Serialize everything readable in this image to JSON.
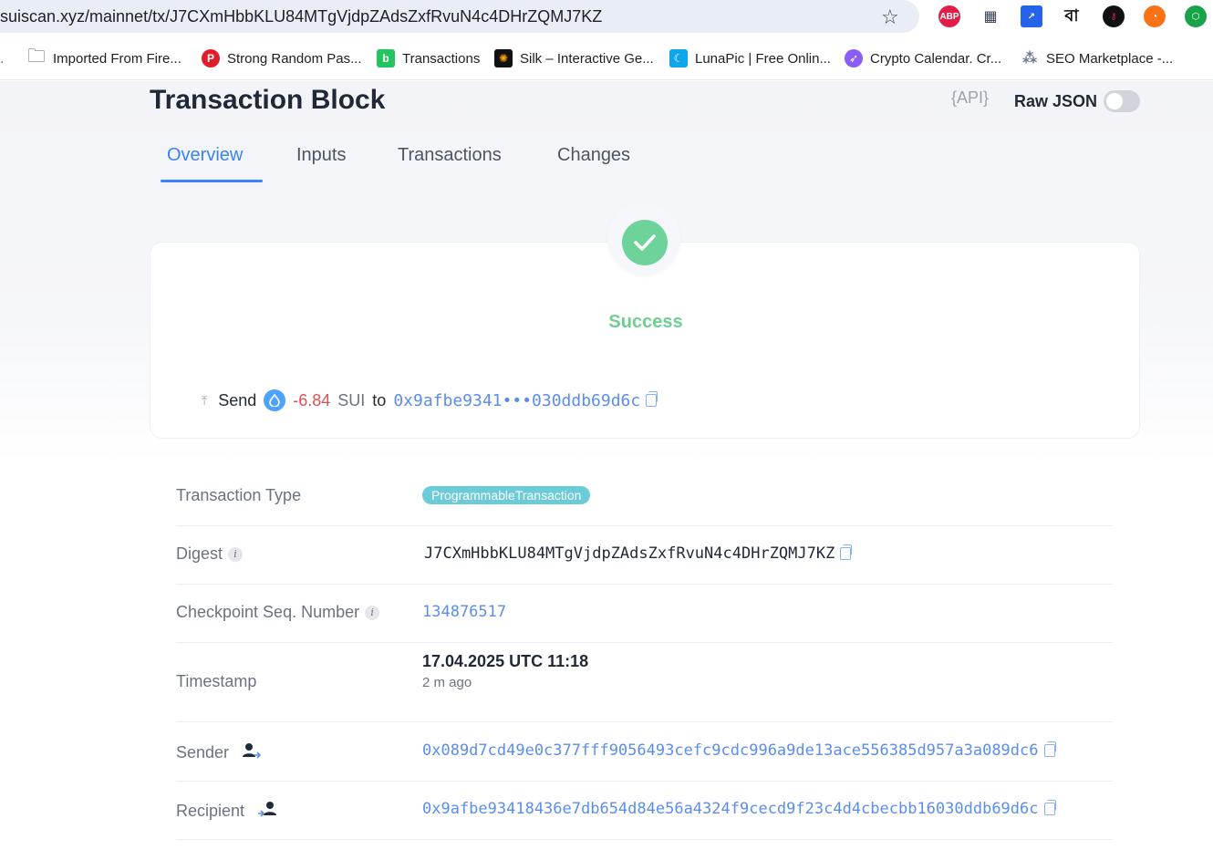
{
  "browser": {
    "url": "suiscan.xyz/mainnet/tx/J7CXmHbbKLU84MTgVjdpZAdsZxfRvuN4c4DHrZQMJ7KZ",
    "star_icon": "star-icon",
    "extensions": [
      {
        "name": "ABP",
        "color": "#e11d48"
      },
      {
        "name": "qr",
        "color": "#374151"
      },
      {
        "name": "bookmark",
        "color": "#2563eb"
      },
      {
        "name": "বা",
        "color": "#111111"
      },
      {
        "name": "key",
        "color": "#111111"
      },
      {
        "name": "rss",
        "color": "#f97316"
      },
      {
        "name": "hex",
        "color": "#16a34a"
      }
    ],
    "bookmarks": [
      {
        "label": "Imported From Fire..."
      },
      {
        "label": "Strong Random Pas..."
      },
      {
        "label": "Transactions"
      },
      {
        "label": "Silk – Interactive Ge..."
      },
      {
        "label": "LunaPic | Free Onlin..."
      },
      {
        "label": "Crypto Calendar. Cr..."
      },
      {
        "label": "SEO Marketplace -..."
      }
    ]
  },
  "header": {
    "title": "Transaction Block",
    "api_label": "{API}",
    "raw_json_label": "Raw JSON"
  },
  "tabs": [
    {
      "label": "Overview",
      "active": true
    },
    {
      "label": "Inputs"
    },
    {
      "label": "Transactions"
    },
    {
      "label": "Changes"
    }
  ],
  "summary": {
    "status": "Success",
    "action": "Send",
    "amount": "-6.84",
    "unit": "SUI",
    "to_label": "to",
    "to_address_short": "0x9afbe9341•••030ddb69d6c"
  },
  "details": {
    "type_label": "Transaction Type",
    "type_value": "ProgrammableTransaction",
    "digest_label": "Digest",
    "digest_value": "J7CXmHbbKLU84MTgVjdpZAdsZxfRvuN4c4DHrZQMJ7KZ",
    "checkpoint_label": "Checkpoint Seq. Number",
    "checkpoint_value": "134876517",
    "timestamp_label": "Timestamp",
    "timestamp_value": "17.04.2025 UTC 11:18",
    "timestamp_ago": "2 m ago",
    "sender_label": "Sender",
    "sender_value": "0x089d7cd49e0c377fff9056493cefc9cdc996a9de13ace556385d957a3a089dc6",
    "recipient_label": "Recipient",
    "recipient_value": "0x9afbe93418436e7db654d84e56a4324f9cecd9f23c4d4cbecbb16030ddb69d6c"
  },
  "colors": {
    "accent": "#3b82f6",
    "success": "#6ed39a",
    "negative": "#e05252",
    "badge": "#6ccbd8"
  }
}
